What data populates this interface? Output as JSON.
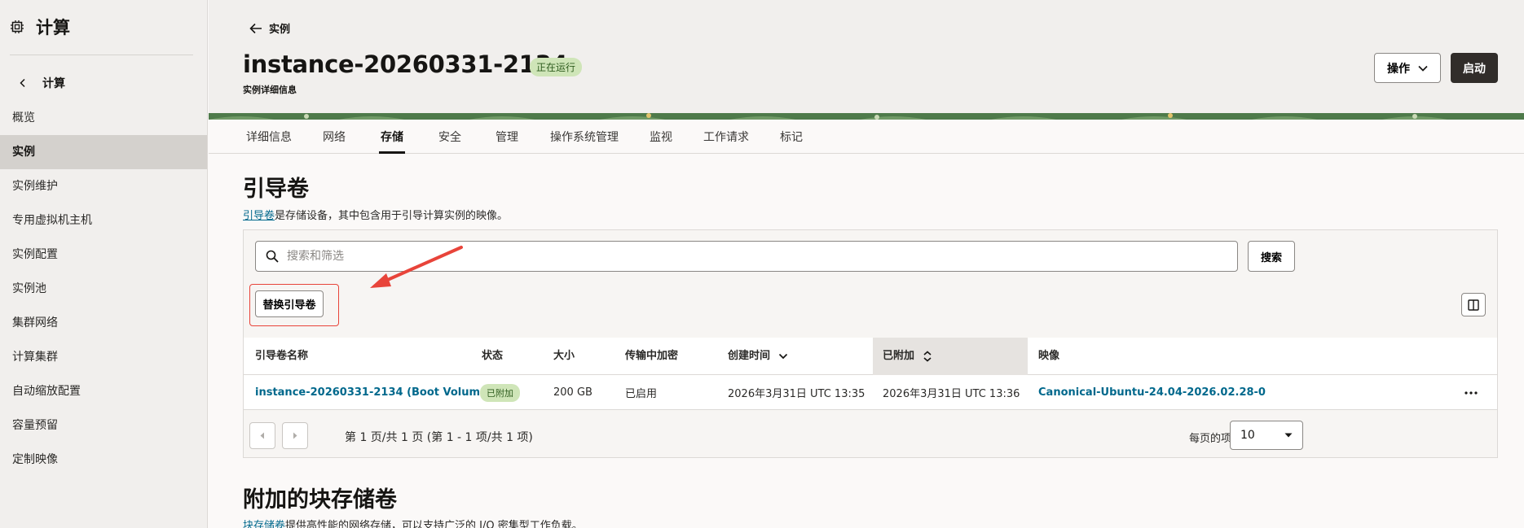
{
  "sidebar": {
    "title": "计算",
    "back_label": "计算",
    "items": [
      {
        "label": "概览"
      },
      {
        "label": "实例",
        "active": true
      },
      {
        "label": "实例维护"
      },
      {
        "label": "专用虚拟机主机"
      },
      {
        "label": "实例配置"
      },
      {
        "label": "实例池"
      },
      {
        "label": "集群网络"
      },
      {
        "label": "计算集群"
      },
      {
        "label": "自动缩放配置"
      },
      {
        "label": "容量预留"
      },
      {
        "label": "定制映像"
      }
    ]
  },
  "header": {
    "back_label": "实例",
    "title": "instance-20260331-2134",
    "status": "正在运行",
    "subtitle": "实例详细信息",
    "actions_label": "操作",
    "start_label": "启动"
  },
  "tabs": [
    {
      "label": "详细信息"
    },
    {
      "label": "网络"
    },
    {
      "label": "存储",
      "active": true
    },
    {
      "label": "安全"
    },
    {
      "label": "管理"
    },
    {
      "label": "操作系统管理"
    },
    {
      "label": "监视"
    },
    {
      "label": "工作请求"
    },
    {
      "label": "标记"
    }
  ],
  "boot_volume": {
    "title": "引导卷",
    "desc_link": "引导卷",
    "desc_rest": "是存储设备，其中包含用于引导计算实例的映像。",
    "search_placeholder": "搜索和筛选",
    "search_button": "搜索",
    "replace_button": "替换引导卷",
    "columns": [
      "引导卷名称",
      "状态",
      "大小",
      "传输中加密",
      "创建时间",
      "已附加",
      "映像"
    ],
    "rows": [
      {
        "name": "instance-20260331-2134 (Boot Volume)",
        "state": "已附加",
        "size": "200 GB",
        "encryption": "已启用",
        "created": "2026年3月31日 UTC 13:35",
        "attached": "2026年3月31日 UTC 13:36",
        "image": "Canonical-Ubuntu-24.04-2026.02.28-0"
      }
    ],
    "pager_text": "第 1 页/共 1 页 (第 1 - 1 项/共 1 项)",
    "per_page_label": "每页的项数",
    "per_page_value": "10"
  },
  "block_volume": {
    "title": "附加的块存储卷",
    "desc_link": "块存储卷",
    "desc_rest": "提供高性能的网络存储，可以支持广泛的 I/O 密集型工作负载。"
  },
  "colors": {
    "accent_link": "#00688c",
    "status_green": "#cfe5b8",
    "annotation_red": "#e8443a",
    "primary_button": "#312d2a"
  }
}
